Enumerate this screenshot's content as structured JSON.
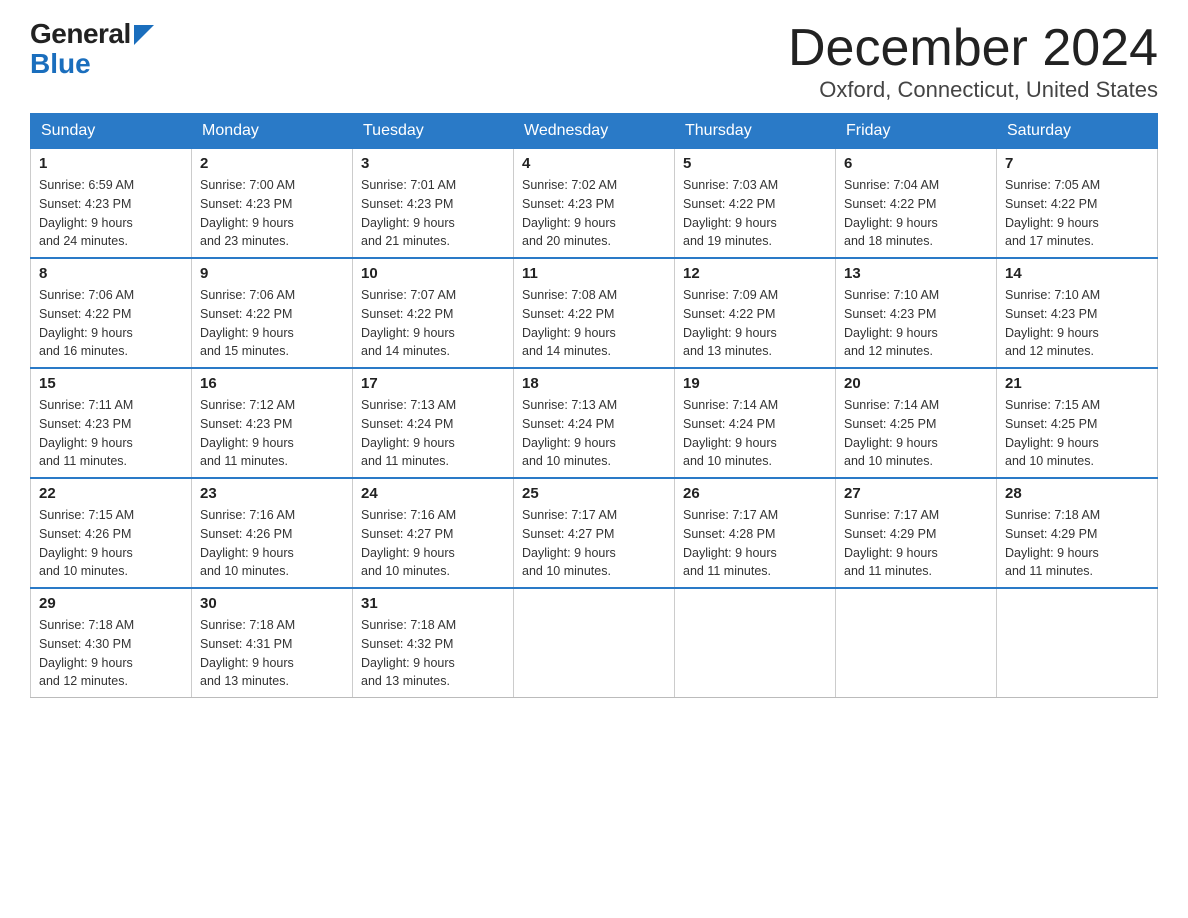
{
  "logo": {
    "general": "General",
    "blue": "Blue"
  },
  "title": {
    "month": "December 2024",
    "location": "Oxford, Connecticut, United States"
  },
  "weekdays": [
    "Sunday",
    "Monday",
    "Tuesday",
    "Wednesday",
    "Thursday",
    "Friday",
    "Saturday"
  ],
  "weeks": [
    [
      {
        "num": "1",
        "sunrise": "6:59 AM",
        "sunset": "4:23 PM",
        "daylight": "9 hours and 24 minutes."
      },
      {
        "num": "2",
        "sunrise": "7:00 AM",
        "sunset": "4:23 PM",
        "daylight": "9 hours and 23 minutes."
      },
      {
        "num": "3",
        "sunrise": "7:01 AM",
        "sunset": "4:23 PM",
        "daylight": "9 hours and 21 minutes."
      },
      {
        "num": "4",
        "sunrise": "7:02 AM",
        "sunset": "4:23 PM",
        "daylight": "9 hours and 20 minutes."
      },
      {
        "num": "5",
        "sunrise": "7:03 AM",
        "sunset": "4:22 PM",
        "daylight": "9 hours and 19 minutes."
      },
      {
        "num": "6",
        "sunrise": "7:04 AM",
        "sunset": "4:22 PM",
        "daylight": "9 hours and 18 minutes."
      },
      {
        "num": "7",
        "sunrise": "7:05 AM",
        "sunset": "4:22 PM",
        "daylight": "9 hours and 17 minutes."
      }
    ],
    [
      {
        "num": "8",
        "sunrise": "7:06 AM",
        "sunset": "4:22 PM",
        "daylight": "9 hours and 16 minutes."
      },
      {
        "num": "9",
        "sunrise": "7:06 AM",
        "sunset": "4:22 PM",
        "daylight": "9 hours and 15 minutes."
      },
      {
        "num": "10",
        "sunrise": "7:07 AM",
        "sunset": "4:22 PM",
        "daylight": "9 hours and 14 minutes."
      },
      {
        "num": "11",
        "sunrise": "7:08 AM",
        "sunset": "4:22 PM",
        "daylight": "9 hours and 14 minutes."
      },
      {
        "num": "12",
        "sunrise": "7:09 AM",
        "sunset": "4:22 PM",
        "daylight": "9 hours and 13 minutes."
      },
      {
        "num": "13",
        "sunrise": "7:10 AM",
        "sunset": "4:23 PM",
        "daylight": "9 hours and 12 minutes."
      },
      {
        "num": "14",
        "sunrise": "7:10 AM",
        "sunset": "4:23 PM",
        "daylight": "9 hours and 12 minutes."
      }
    ],
    [
      {
        "num": "15",
        "sunrise": "7:11 AM",
        "sunset": "4:23 PM",
        "daylight": "9 hours and 11 minutes."
      },
      {
        "num": "16",
        "sunrise": "7:12 AM",
        "sunset": "4:23 PM",
        "daylight": "9 hours and 11 minutes."
      },
      {
        "num": "17",
        "sunrise": "7:13 AM",
        "sunset": "4:24 PM",
        "daylight": "9 hours and 11 minutes."
      },
      {
        "num": "18",
        "sunrise": "7:13 AM",
        "sunset": "4:24 PM",
        "daylight": "9 hours and 10 minutes."
      },
      {
        "num": "19",
        "sunrise": "7:14 AM",
        "sunset": "4:24 PM",
        "daylight": "9 hours and 10 minutes."
      },
      {
        "num": "20",
        "sunrise": "7:14 AM",
        "sunset": "4:25 PM",
        "daylight": "9 hours and 10 minutes."
      },
      {
        "num": "21",
        "sunrise": "7:15 AM",
        "sunset": "4:25 PM",
        "daylight": "9 hours and 10 minutes."
      }
    ],
    [
      {
        "num": "22",
        "sunrise": "7:15 AM",
        "sunset": "4:26 PM",
        "daylight": "9 hours and 10 minutes."
      },
      {
        "num": "23",
        "sunrise": "7:16 AM",
        "sunset": "4:26 PM",
        "daylight": "9 hours and 10 minutes."
      },
      {
        "num": "24",
        "sunrise": "7:16 AM",
        "sunset": "4:27 PM",
        "daylight": "9 hours and 10 minutes."
      },
      {
        "num": "25",
        "sunrise": "7:17 AM",
        "sunset": "4:27 PM",
        "daylight": "9 hours and 10 minutes."
      },
      {
        "num": "26",
        "sunrise": "7:17 AM",
        "sunset": "4:28 PM",
        "daylight": "9 hours and 11 minutes."
      },
      {
        "num": "27",
        "sunrise": "7:17 AM",
        "sunset": "4:29 PM",
        "daylight": "9 hours and 11 minutes."
      },
      {
        "num": "28",
        "sunrise": "7:18 AM",
        "sunset": "4:29 PM",
        "daylight": "9 hours and 11 minutes."
      }
    ],
    [
      {
        "num": "29",
        "sunrise": "7:18 AM",
        "sunset": "4:30 PM",
        "daylight": "9 hours and 12 minutes."
      },
      {
        "num": "30",
        "sunrise": "7:18 AM",
        "sunset": "4:31 PM",
        "daylight": "9 hours and 13 minutes."
      },
      {
        "num": "31",
        "sunrise": "7:18 AM",
        "sunset": "4:32 PM",
        "daylight": "9 hours and 13 minutes."
      },
      null,
      null,
      null,
      null
    ]
  ]
}
